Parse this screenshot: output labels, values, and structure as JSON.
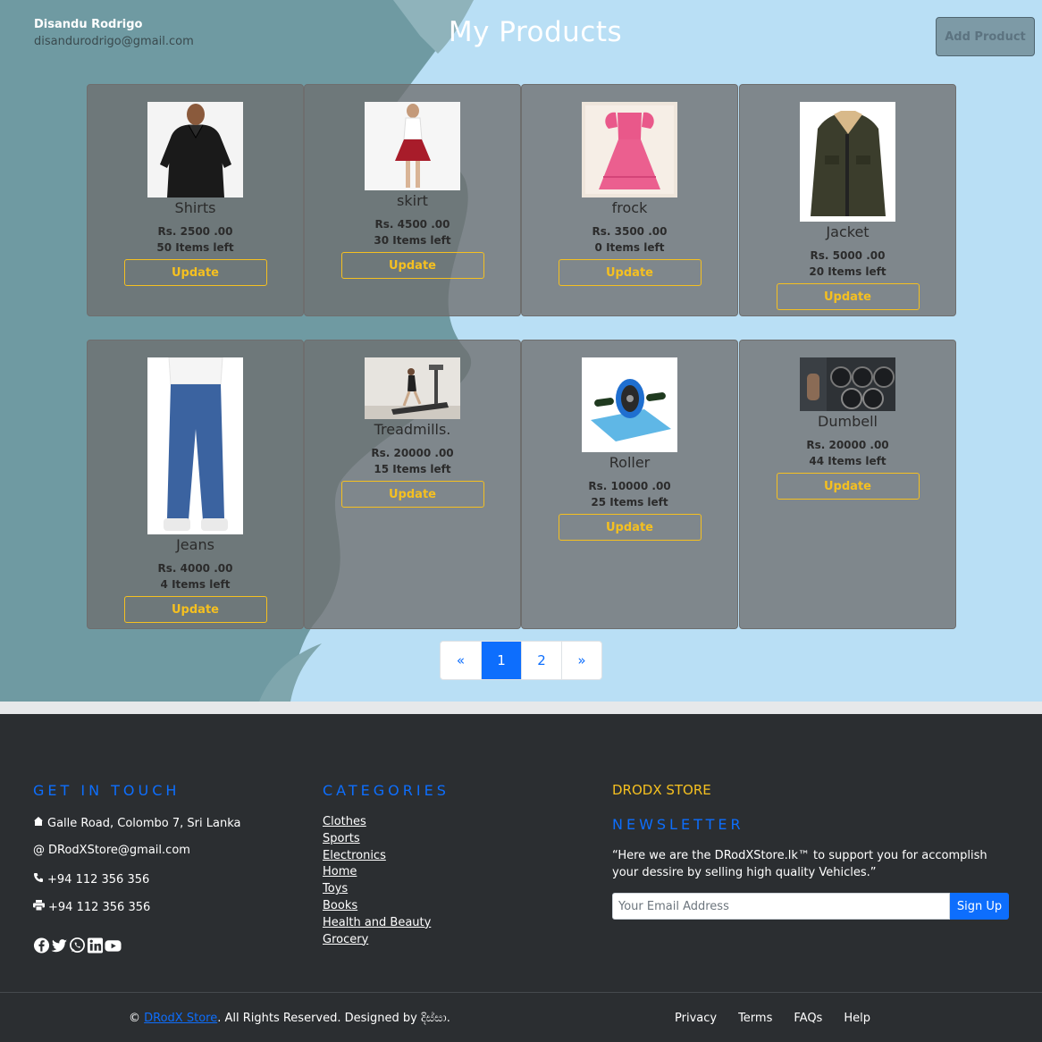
{
  "header": {
    "user_name": "Disandu Rodrigo",
    "user_email": "disandurodrigo@gmail.com",
    "title": "My Products",
    "add_button": "Add Product"
  },
  "products": [
    {
      "name": "Shirts",
      "price": "Rs. 2500 .00",
      "stock": "50 Items left",
      "button": "Update",
      "image": "black-shirt-photo"
    },
    {
      "name": "skirt",
      "price": "Rs. 4500 .00",
      "stock": "30 Items left",
      "button": "Update",
      "image": "red-skirt-photo"
    },
    {
      "name": "frock",
      "price": "Rs. 3500 .00",
      "stock": "0 Items left",
      "button": "Update",
      "image": "pink-frock-photo"
    },
    {
      "name": "Jacket",
      "price": "Rs. 5000 .00",
      "stock": "20 Items left",
      "button": "Update",
      "image": "green-jacket-photo"
    },
    {
      "name": "Jeans",
      "price": "Rs. 4000 .00",
      "stock": "4 Items left",
      "button": "Update",
      "image": "blue-jeans-photo"
    },
    {
      "name": "Treadmills.",
      "price": "Rs. 20000 .00",
      "stock": "15 Items left",
      "button": "Update",
      "image": "treadmill-photo"
    },
    {
      "name": "Roller",
      "price": "Rs. 10000 .00",
      "stock": "25 Items left",
      "button": "Update",
      "image": "ab-roller-photo"
    },
    {
      "name": "Dumbell",
      "price": "Rs. 20000 .00",
      "stock": "44 Items left",
      "button": "Update",
      "image": "dumbbell-rack-photo"
    }
  ],
  "pagination": {
    "prev": "«",
    "pages": [
      "1",
      "2"
    ],
    "active": "1",
    "next": "»"
  },
  "footer": {
    "contact_heading": "GET IN TOUCH",
    "address": "Galle Road, Colombo 7, Sri Lanka",
    "email": "DRodXStore@gmail.com",
    "phone": "+94 112 356 356",
    "fax": "+94 112 356 356",
    "categories_heading": "CATEGORIES",
    "categories": [
      "Clothes",
      "Sports",
      "Electronics",
      "Home",
      "Toys",
      "Books",
      "Health and Beauty",
      "Grocery"
    ],
    "store_heading": "DRODX STORE",
    "newsletter_heading": "NEWSLETTER",
    "newsletter_text": "“Here we are the DRodXStore.lk™ to support you for accomplish your dessire by selling high quality Vehicles.”",
    "email_placeholder": "Your Email Address",
    "signup_button": "Sign Up",
    "socials": [
      "facebook-icon",
      "twitter-icon",
      "whatsapp-icon",
      "linkedin-icon",
      "youtube-icon"
    ],
    "copyright_prefix": "©",
    "copyright_link": "DRodX Store",
    "copyright_suffix": ". All Rights Reserved. Designed by දිස්සා.",
    "links": [
      "Privacy",
      "Terms",
      "FAQs",
      "Help"
    ]
  },
  "colors": {
    "accent": "#0d6efd",
    "update": "#f5c020",
    "footer_bg": "#2b2e31"
  }
}
